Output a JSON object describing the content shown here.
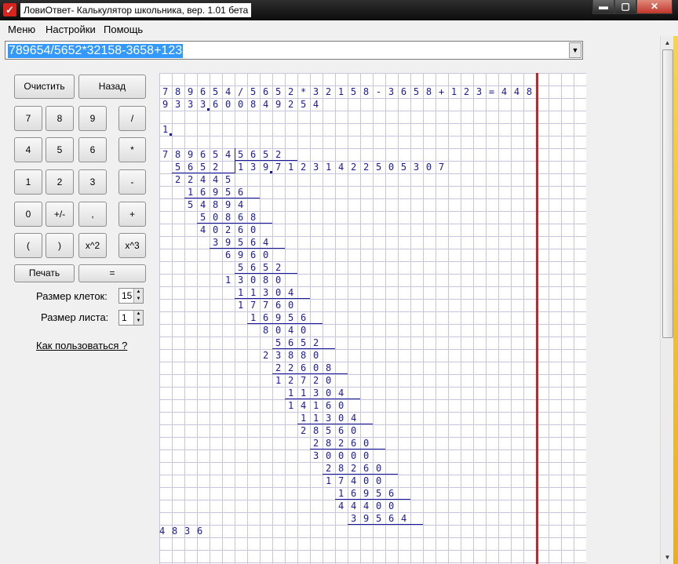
{
  "window": {
    "title": "ЛовиОтвет- Калькулятор школьника, вер.  1.01 бета",
    "minimize": "▬",
    "maximize": "▢",
    "close": "✕"
  },
  "menu": [
    "Меню",
    "Настройки",
    "Помощь"
  ],
  "expression": {
    "value": "789654/5652*32158-3658+123",
    "dropdown_icon": "▼"
  },
  "buttons": {
    "clear": "Очистить",
    "back": "Назад",
    "rows": [
      [
        "7",
        "8",
        "9",
        "/"
      ],
      [
        "4",
        "5",
        "6",
        "*"
      ],
      [
        "1",
        "2",
        "3",
        "-"
      ],
      [
        "0",
        "+/-",
        ",",
        "+"
      ],
      [
        "(",
        ")",
        "x^2",
        "x^3"
      ]
    ],
    "print": "Печать",
    "equals": "="
  },
  "settings": {
    "cell_size_label": "Размер клеток:",
    "cell_size_value": "15",
    "sheet_size_label": "Размер листа:",
    "sheet_size_value": "1"
  },
  "help_link": "Как пользоваться ?",
  "icons": {
    "app": "red-checkmark-icon",
    "spin_up": "▲",
    "spin_down": "▼",
    "scroll_up": "▲",
    "scroll_down": "▼"
  },
  "colors": {
    "ink": "#1a1a9a",
    "margin_line": "#e01a1a",
    "grid": "#c5c5dc"
  },
  "worksheet": {
    "expression_line": "789654/5652*32158-3658+123=448",
    "result_line": "9333600849254",
    "partial_line": "1",
    "dividend": "789654",
    "divisor": "5652",
    "quotient": "13971231422505307",
    "steps": [
      "5652",
      "22445",
      "16956",
      "54894",
      "50868",
      "40260",
      "39564",
      "6960",
      "5652",
      "13080",
      "11304",
      "17760",
      "16956",
      "8040",
      "5652",
      "23880",
      "22608",
      "12720",
      "11304",
      "14160",
      "11304",
      "28560",
      "28260",
      "30000",
      "28260",
      "17400",
      "16956",
      "44400",
      "39564",
      "4836"
    ]
  }
}
